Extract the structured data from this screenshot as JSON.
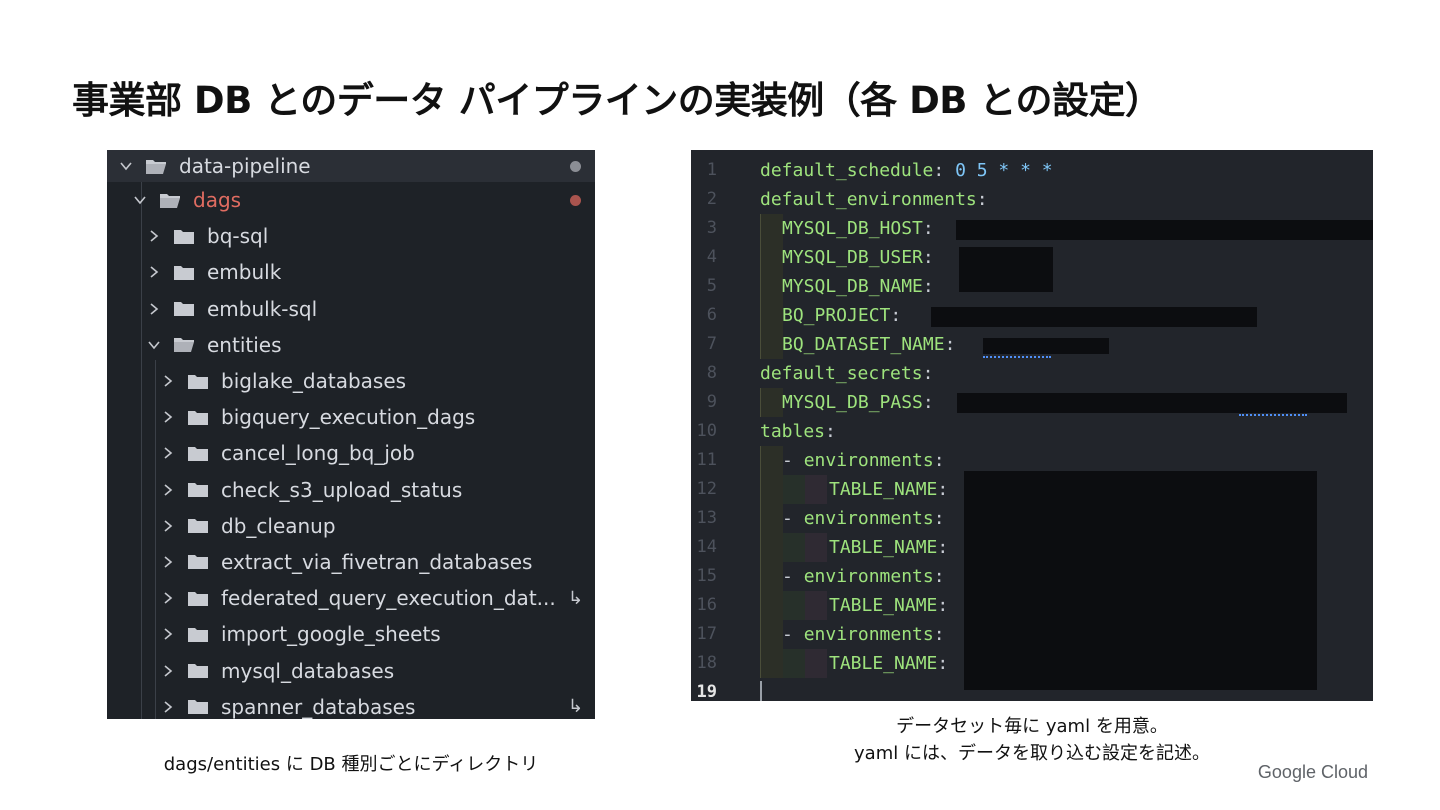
{
  "slide": {
    "title": "事業部 DB とのデータ パイプラインの実装例（各  DB との設定）",
    "caption_left": "dags/entities に DB 種別ごとにディレクトリ",
    "caption_right_line1": "データセット毎に yaml を用意。",
    "caption_right_line2": "yaml には、データを取り込む設定を記述。",
    "brand": "Google Cloud"
  },
  "explorer": {
    "root": "data-pipeline",
    "dags": "dags",
    "children": [
      "bq-sql",
      "embulk",
      "embulk-sql",
      "entities"
    ],
    "entities": [
      "biglake_databases",
      "bigquery_execution_dags",
      "cancel_long_bq_job",
      "check_s3_upload_status",
      "db_cleanup",
      "extract_via_fivetran_databases",
      "federated_query_execution_dat...",
      "import_google_sheets",
      "mysql_databases",
      "spanner_databases"
    ],
    "colors": {
      "modified": "#e06c61",
      "untracked": "#8b8e95",
      "folder": "#c8cbd1"
    }
  },
  "editor": {
    "line_numbers": [
      "1",
      "2",
      "3",
      "4",
      "5",
      "6",
      "7",
      "8",
      "9",
      "10",
      "11",
      "12",
      "13",
      "14",
      "15",
      "16",
      "17",
      "18",
      "19"
    ],
    "keys": {
      "default_schedule": "default_schedule",
      "schedule_value": "0 5 * * *",
      "default_environments": "default_environments",
      "mysql_db_host": "MYSQL_DB_HOST",
      "mysql_db_user": "MYSQL_DB_USER",
      "mysql_db_name": "MYSQL_DB_NAME",
      "bq_project": "BQ_PROJECT",
      "bq_dataset_name": "BQ_DATASET_NAME",
      "default_secrets": "default_secrets",
      "mysql_db_pass": "MYSQL_DB_PASS",
      "tables": "tables",
      "environments": "environments",
      "table_name": "TABLE_NAME"
    },
    "colors": {
      "key": "#9ee37d",
      "value": "#7fc6f7",
      "background": "#22252b"
    }
  }
}
